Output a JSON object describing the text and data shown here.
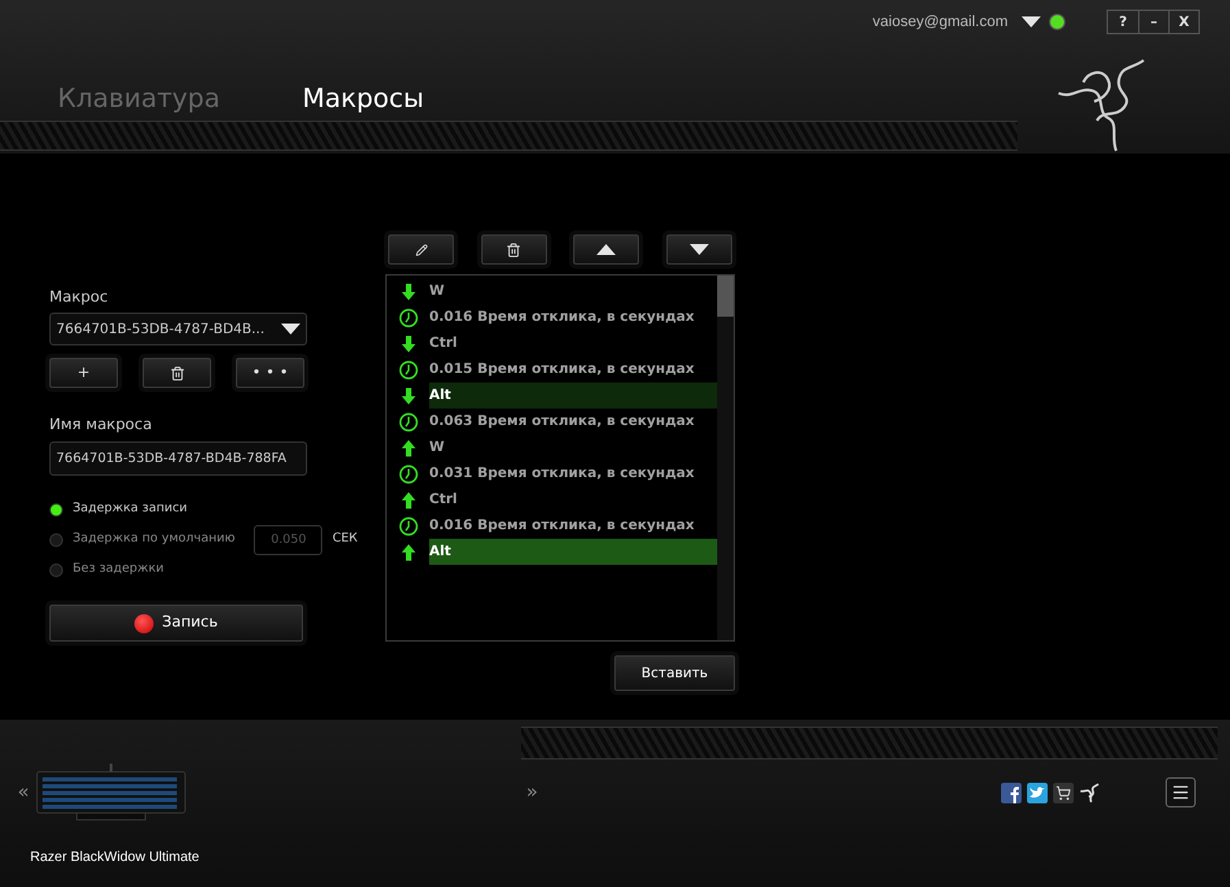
{
  "account": {
    "email": "vaiosey@gmail.com",
    "online": true
  },
  "window_buttons": [
    "?",
    "–",
    "X"
  ],
  "tabs": [
    {
      "label": "Клавиатура",
      "selected": false
    },
    {
      "label": "Макросы",
      "selected": true
    }
  ],
  "macro": {
    "label": "Макрос",
    "selected_macro": "7664701B-53DB-4787-BD4B...",
    "name_label": "Имя макроса",
    "name_value": "7664701B-53DB-4787-BD4B-788FA"
  },
  "macro_buttons": [
    {
      "kind": "add",
      "label": "+"
    },
    {
      "kind": "delete"
    },
    {
      "kind": "more",
      "label": "• • •"
    }
  ],
  "delay_options": [
    {
      "label": "Задержка записи",
      "selected": true
    },
    {
      "label": "Задержка по умолчанию",
      "selected": false
    },
    {
      "label": "Без задержки",
      "selected": false
    }
  ],
  "default_delay": {
    "value": "0.050",
    "unit": "СЕК"
  },
  "record_button": "Запись",
  "event_toolbar": [
    {
      "kind": "edit"
    },
    {
      "kind": "delete"
    },
    {
      "kind": "move_up"
    },
    {
      "kind": "move_down"
    }
  ],
  "events": [
    {
      "kind": "key_down",
      "text": "W",
      "selected": false,
      "paired": false
    },
    {
      "kind": "delay",
      "text": "0.016 Время отклика, в секундах",
      "selected": false,
      "paired": false
    },
    {
      "kind": "key_down",
      "text": "Ctrl",
      "selected": false,
      "paired": false
    },
    {
      "kind": "delay",
      "text": "0.015 Время отклика, в секундах",
      "selected": false,
      "paired": false
    },
    {
      "kind": "key_down",
      "text": "Alt",
      "selected": false,
      "paired": true
    },
    {
      "kind": "delay",
      "text": "0.063 Время отклика, в секундах",
      "selected": false,
      "paired": false
    },
    {
      "kind": "key_up",
      "text": "W",
      "selected": false,
      "paired": false
    },
    {
      "kind": "delay",
      "text": "0.031 Время отклика, в секундах",
      "selected": false,
      "paired": false
    },
    {
      "kind": "key_up",
      "text": "Ctrl",
      "selected": false,
      "paired": false
    },
    {
      "kind": "delay",
      "text": "0.016 Время отклика, в секундах",
      "selected": false,
      "paired": false
    },
    {
      "kind": "key_up",
      "text": "Alt",
      "selected": true,
      "paired": false
    }
  ],
  "insert_button": "Вставить",
  "device": {
    "name": "Razer BlackWidow Ultimate",
    "prev": "«",
    "next": "»"
  }
}
